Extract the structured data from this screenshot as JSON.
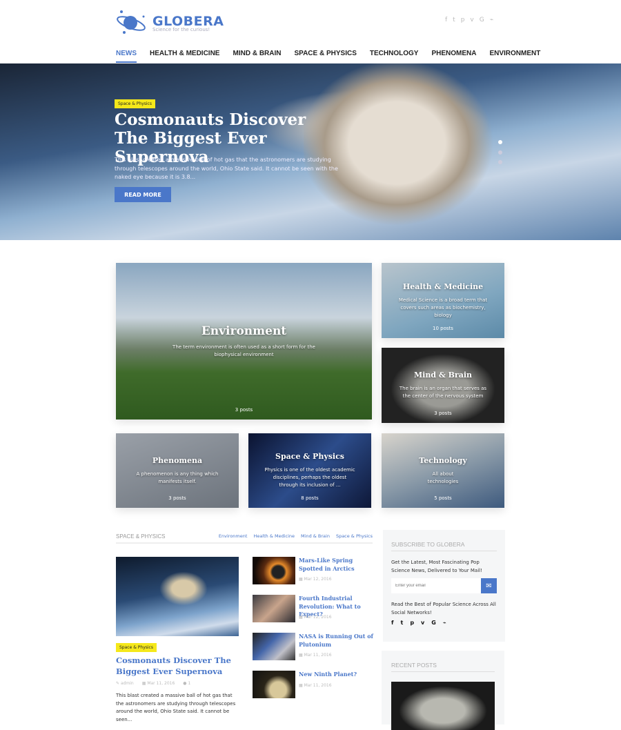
{
  "header": {
    "logo": "GLOBERA",
    "tagline": "Science for the curious!",
    "social": [
      "f",
      "t",
      "p",
      "v",
      "G",
      "rss"
    ]
  },
  "nav": [
    {
      "label": "NEWS",
      "active": true
    },
    {
      "label": "HEALTH & MEDICINE"
    },
    {
      "label": "MIND & BRAIN"
    },
    {
      "label": "SPACE & PHYSICS"
    },
    {
      "label": "TECHNOLOGY"
    },
    {
      "label": "PHENOMENA"
    },
    {
      "label": "ENVIRONMENT"
    }
  ],
  "hero": {
    "tag": "Space & Physics",
    "title": "Cosmonauts Discover The Biggest Ever Supernova",
    "text": "This blast created a massive ball of hot gas that the astronomers are studying through telescopes around the world, Ohio State said. It cannot be seen with the naked eye because it is 3.8...",
    "button": "READ MORE",
    "slide_count": 3,
    "active_slide": 1
  },
  "categories": [
    {
      "title": "Environment",
      "desc": "The term environment is often used as a short form for the biophysical environment",
      "posts": "3 posts"
    },
    {
      "title": "Health & Medicine",
      "desc": "Medical Science is a broad term that covers such areas as biochemistry, biology",
      "posts": "10 posts"
    },
    {
      "title": "Mind & Brain",
      "desc": "The brain is an organ that serves as the center of the nervous system",
      "posts": "3 posts"
    },
    {
      "title": "Phenomena",
      "desc": "A phenomenon is any thing which manifests itself.",
      "posts": "3 posts"
    },
    {
      "title": "Space & Physics",
      "desc": "Physics is one of the oldest academic disciplines, perhaps the oldest through its inclusion of ...",
      "posts": "8 posts"
    },
    {
      "title": "Technology",
      "desc": "All about technologies",
      "posts": "5 posts"
    }
  ],
  "section": {
    "title": "SPACE & PHYSICS",
    "filters": [
      "Environment",
      "Health & Medicine",
      "Mind & Brain",
      "Space & Physics"
    ],
    "main": {
      "tag": "Space & Physics",
      "title": "Cosmonauts Discover The Biggest Ever Supernova",
      "author": "admin",
      "date": "Mar 11, 2016",
      "comments": "1",
      "excerpt": "This blast created a massive ball of hot gas that the astronomers are studying through telescopes around the world, Ohio State said. It cannot be seen..."
    },
    "list": [
      {
        "title": "Mars-Like Spring Spotted in Arctics",
        "date": "Mar 12, 2016"
      },
      {
        "title": "Fourth Industrial Revolution: What to Expect?",
        "date": "Mar 12, 2016"
      },
      {
        "title": "NASA is Running Out of Plutonium",
        "date": "Mar 11, 2016"
      },
      {
        "title": "New Ninth Planet?",
        "date": "Mar 11, 2016"
      }
    ]
  },
  "subscribe": {
    "title": "SUBSCRIBE TO GLOBERA",
    "text": "Get the Latest, Most Fascinating Pop Science News, Delivered to Your Mail!",
    "placeholder": "Enter your email",
    "social_text": "Read the Best of Popular Science Across All Social Networks!",
    "social": [
      "f",
      "t",
      "p",
      "v",
      "G",
      "rss"
    ]
  },
  "recent": {
    "title": "RECENT POSTS"
  }
}
